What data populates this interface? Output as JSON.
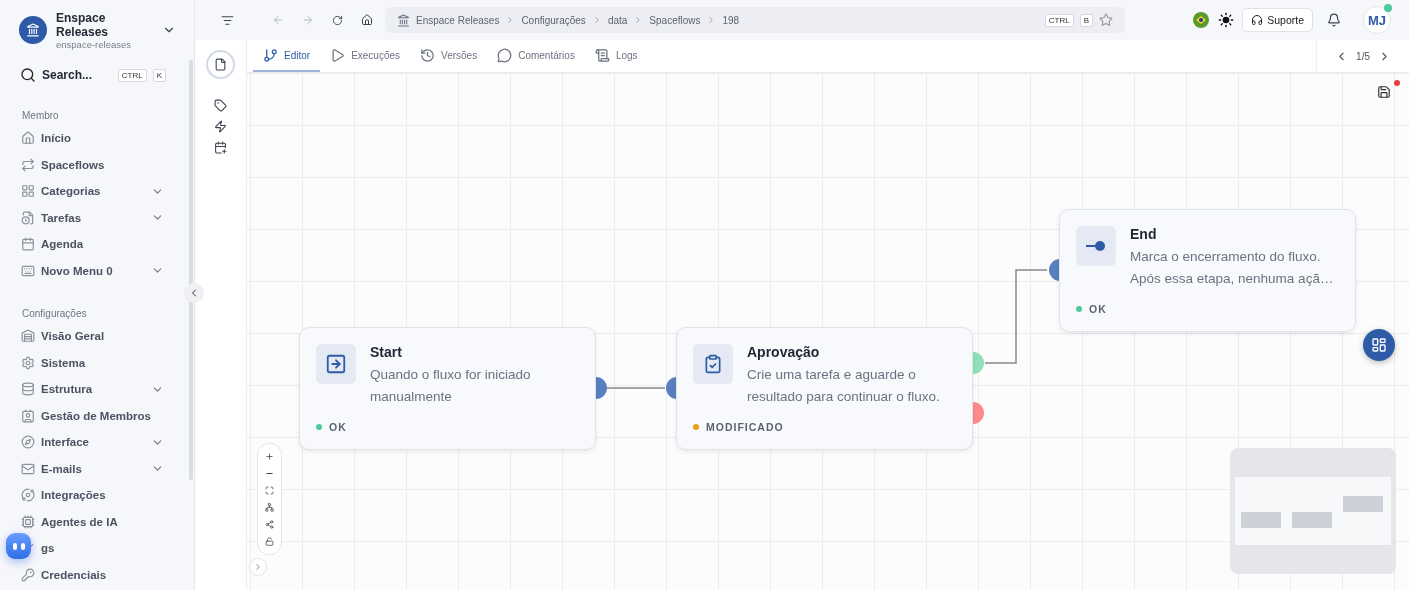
{
  "workspace": {
    "name": "Enspace Releases",
    "slug": "enspace-releases"
  },
  "search": {
    "placeholder": "Search...",
    "shortcut": [
      "CTRL",
      "K"
    ]
  },
  "sidebar": {
    "sections": [
      {
        "title": "Membro",
        "items": [
          {
            "label": "Início",
            "expandable": false
          },
          {
            "label": "Spaceflows",
            "expandable": false
          },
          {
            "label": "Categorias",
            "expandable": true
          },
          {
            "label": "Tarefas",
            "expandable": true
          },
          {
            "label": "Agenda",
            "expandable": false
          },
          {
            "label": "Novo Menu 0",
            "expandable": true
          }
        ]
      },
      {
        "title": "Configurações",
        "items": [
          {
            "label": "Visão Geral",
            "expandable": false
          },
          {
            "label": "Sistema",
            "expandable": false
          },
          {
            "label": "Estrutura",
            "expandable": true
          },
          {
            "label": "Gestão de Membros",
            "expandable": false
          },
          {
            "label": "Interface",
            "expandable": true
          },
          {
            "label": "E-mails",
            "expandable": true
          },
          {
            "label": "Integrações",
            "expandable": false
          },
          {
            "label": "Agentes de IA",
            "expandable": false
          },
          {
            "label": "gs",
            "expandable": false
          },
          {
            "label": "Credenciais",
            "expandable": false
          }
        ]
      }
    ]
  },
  "breadcrumb": [
    "Enspace Releases",
    "Configurações",
    "data",
    "Spaceflows",
    "198"
  ],
  "bookmark_shortcut": [
    "CTRL",
    "B"
  ],
  "support_button": "Suporte",
  "user": {
    "initials": "MJ",
    "online": true
  },
  "tabs": [
    {
      "label": "Editor",
      "selected": true
    },
    {
      "label": "Execuções",
      "selected": false
    },
    {
      "label": "Versões",
      "selected": false
    },
    {
      "label": "Comentários",
      "selected": false
    },
    {
      "label": "Logs",
      "selected": false
    }
  ],
  "pager": "1/5",
  "unsaved": true,
  "nodes": [
    {
      "kind": "start",
      "title": "Start",
      "description": "Quando o fluxo for iniciado manualmente",
      "status": "OK",
      "color": "#4fc99a"
    },
    {
      "kind": "approval",
      "title": "Aprovação",
      "description": "Crie uma tarefa e aguarde o resultado para continuar o fluxo.",
      "status": "MODIFICADO",
      "color": "#e8a21a"
    },
    {
      "kind": "end",
      "title": "End",
      "description": "Marca o encerramento do fluxo. Após essa etapa, nenhuma açã…",
      "status": "OK",
      "color": "#4fc99a"
    }
  ]
}
